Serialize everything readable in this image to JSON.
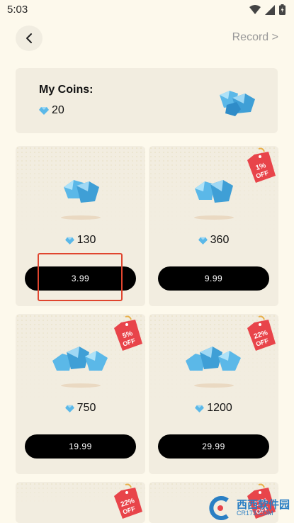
{
  "status": {
    "time": "5:03"
  },
  "header": {
    "record_label": "Record >"
  },
  "coins": {
    "title": "My Coins:",
    "value": "20"
  },
  "packs": [
    {
      "amount": "130",
      "price": "3.99",
      "discount": ""
    },
    {
      "amount": "360",
      "price": "9.99",
      "discount_line1": "1%",
      "discount_line2": "OFF"
    },
    {
      "amount": "750",
      "price": "19.99",
      "discount_line1": "5%",
      "discount_line2": "OFF"
    },
    {
      "amount": "1200",
      "price": "29.99",
      "discount_line1": "22%",
      "discount_line2": "OFF"
    },
    {
      "discount_line1": "22%",
      "discount_line2": "OFF"
    },
    {
      "discount_line1": "22%",
      "discount_line2": "OFF"
    }
  ],
  "watermark": {
    "brand": "西西软件园",
    "domain": "CR173.COM"
  },
  "colors": {
    "background": "#fdf9ec",
    "card": "#f2ede0",
    "button": "#000000",
    "tag": "#e8444a",
    "highlight": "#e0452f",
    "gem": "#5bb8e8"
  }
}
